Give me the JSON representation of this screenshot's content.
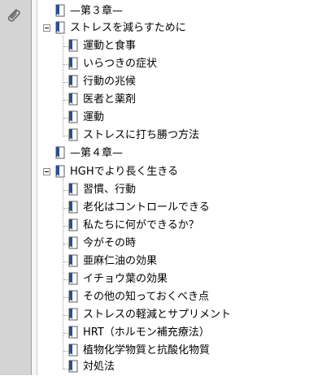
{
  "icons": {
    "attachment": "paperclip-icon",
    "bookmark": "bookmark-icon",
    "collapse": "collapse-minus-icon"
  },
  "colors": {
    "rail": "#d4d4d4",
    "bookmark_fill": "#2a4f8f",
    "bookmark_page": "#ffffff"
  },
  "tree": {
    "items": [
      {
        "label": "—第３章—"
      },
      {
        "label": "ストレスを減らすために"
      },
      {
        "label": "運動と食事"
      },
      {
        "label": "いらつきの症状"
      },
      {
        "label": "行動の兆候"
      },
      {
        "label": "医者と薬剤"
      },
      {
        "label": "運動"
      },
      {
        "label": "ストレスに打ち勝つ方法"
      },
      {
        "label": "—第４章—"
      },
      {
        "label": "HGHでより長く生きる"
      },
      {
        "label": "習慣、行動"
      },
      {
        "label": "老化はコントロールできる"
      },
      {
        "label": "私たちに何ができるか？"
      },
      {
        "label": "今がその時"
      },
      {
        "label": "亜麻仁油の効果"
      },
      {
        "label": "イチョウ葉の効果"
      },
      {
        "label": "その他の知っておくべき点"
      },
      {
        "label": "ストレスの軽減とサプリメント"
      },
      {
        "label": "HRT（ホルモン補充療法）"
      },
      {
        "label": "植物化学物質と抗酸化物質"
      },
      {
        "label": "対処法"
      }
    ]
  }
}
